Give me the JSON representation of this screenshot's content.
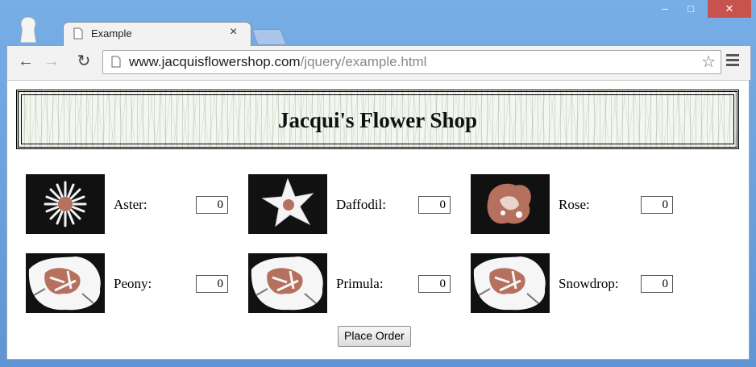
{
  "browser": {
    "tab_title": "Example",
    "tab_close": "×",
    "url_host": "www.jacquisflowershop.com",
    "url_path": "/jquery/example.html",
    "min_glyph": "–",
    "max_glyph": "□",
    "close_glyph": "✕",
    "back_glyph": "←",
    "forward_glyph": "→",
    "reload_glyph": "↻",
    "star_glyph": "☆"
  },
  "page": {
    "title": "Jacqui's Flower Shop",
    "order_button": "Place Order",
    "flowers": [
      {
        "label": "Aster:",
        "value": "0",
        "icon": "aster-icon"
      },
      {
        "label": "Daffodil:",
        "value": "0",
        "icon": "daffodil-icon"
      },
      {
        "label": "Rose:",
        "value": "0",
        "icon": "rose-icon"
      },
      {
        "label": "Peony:",
        "value": "0",
        "icon": "peony-icon"
      },
      {
        "label": "Primula:",
        "value": "0",
        "icon": "primula-icon"
      },
      {
        "label": "Snowdrop:",
        "value": "0",
        "icon": "snowdrop-icon"
      }
    ]
  },
  "colors": {
    "window_frame": "#6a9fd8",
    "close_button": "#c8524d",
    "flower_pink": "#b6705e"
  }
}
